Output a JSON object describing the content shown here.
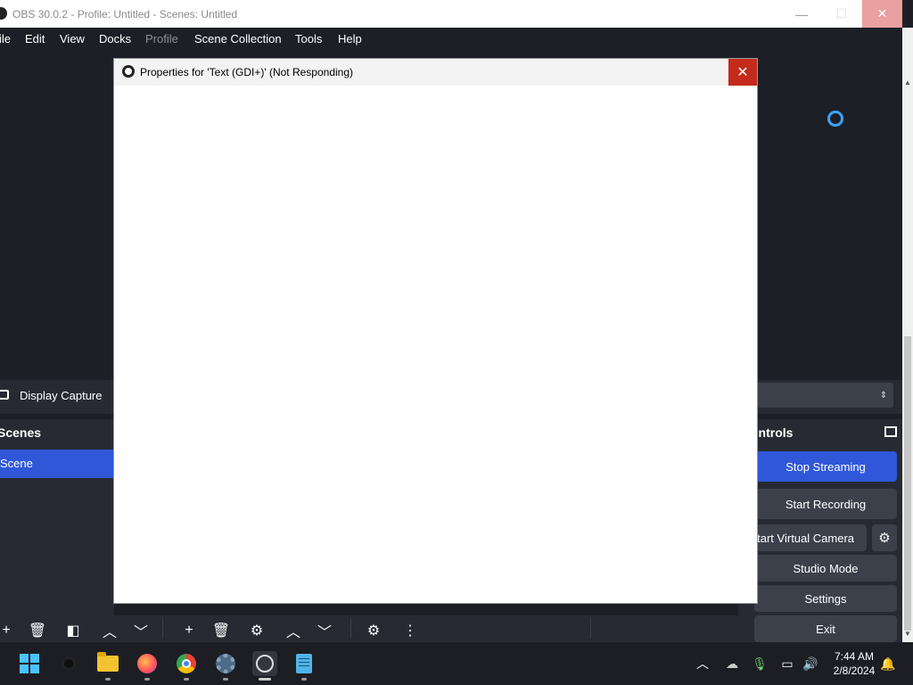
{
  "window": {
    "title": "OBS 30.0.2 - Profile: Untitled - Scenes: Untitled",
    "min_glyph": "—",
    "max_glyph": "☐",
    "close_glyph": "✕"
  },
  "menu": {
    "file": "ile",
    "edit": "Edit",
    "view": "View",
    "docks": "Docks",
    "profile": "Profile",
    "scene_collection": "Scene Collection",
    "tools": "Tools",
    "help": "Help"
  },
  "context": {
    "source_name": "Display Capture"
  },
  "scenes_dock": {
    "title": "Scenes",
    "items": [
      {
        "label": "Scene",
        "selected": true
      }
    ]
  },
  "controls_dock": {
    "title": "ontrols",
    "stop_streaming": "Stop Streaming",
    "start_recording": "Start Recording",
    "start_virtual_camera": "tart Virtual Camera",
    "studio_mode": "Studio Mode",
    "settings": "Settings",
    "exit": "Exit"
  },
  "dialog": {
    "title": "Properties for 'Text (GDI+)' (Not Responding)",
    "close_glyph": "✕"
  },
  "taskbar": {
    "apps": [
      "start",
      "search",
      "file-explorer",
      "firefox",
      "chrome",
      "settings",
      "obs-studio",
      "notepad"
    ],
    "clock_time": "7:44 AM",
    "clock_date": "2/8/2024"
  },
  "colors": {
    "accent": "#2f57d8",
    "dialog_close": "#c42b1c",
    "background": "#1d1f26",
    "panel": "#272a33"
  }
}
